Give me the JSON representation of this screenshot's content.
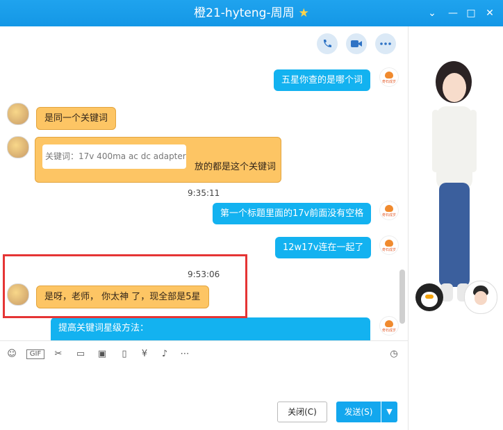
{
  "window": {
    "title": "橙21-hyteng-周周",
    "star": "★",
    "min": "—",
    "max": "□",
    "close": "✕",
    "skin": "⌄"
  },
  "chat": {
    "msg1": "五星你查的是哪个词",
    "msg2": "是同一个关键词",
    "msg3_quote": "关键词：17v 400ma ac dc adapter",
    "msg3_text": "放的都是这个关键词",
    "time1": "9:35:11",
    "msg4": "第一个标题里面的17v前面没有空格",
    "msg5": "12w17v连在一起了",
    "time2": "9:53:06",
    "msg6": "是呀，老师，  你太神 了，现全部是5星",
    "msg7": "提高关键词星级方法："
  },
  "logo_text": "奇石成岁",
  "toolbar": {
    "gif": "GIF"
  },
  "buttons": {
    "close": "关闭(C)",
    "send": "发送(S)"
  },
  "colors": {
    "accent": "#13b2f0",
    "orange": "#fdc564",
    "highlight": "#e53434"
  }
}
